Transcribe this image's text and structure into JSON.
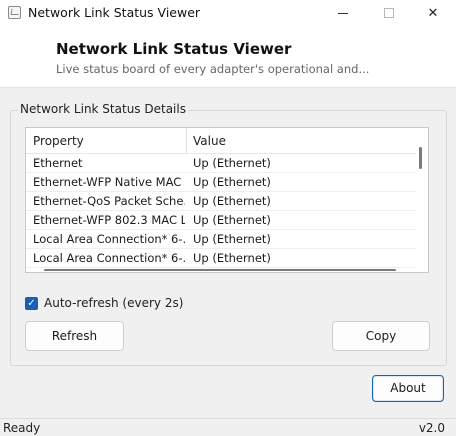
{
  "window": {
    "title": "Network Link Status Viewer",
    "controls": {
      "minimize": "minimize-icon",
      "maximize": "maximize-icon",
      "close": "✕"
    }
  },
  "header": {
    "title": "Network Link Status Viewer",
    "subtitle": "Live status board of every adapter's operational and..."
  },
  "group": {
    "label": "Network Link Status Details",
    "list": {
      "columns": [
        "Property",
        "Value"
      ],
      "rows": [
        {
          "property": "Ethernet",
          "value": "Up (Ethernet)"
        },
        {
          "property": "Ethernet-WFP Native MAC ...",
          "value": "Up (Ethernet)"
        },
        {
          "property": "Ethernet-QoS Packet Sche...",
          "value": "Up (Ethernet)"
        },
        {
          "property": "Ethernet-WFP 802.3 MAC L...",
          "value": "Up (Ethernet)"
        },
        {
          "property": "Local Area Connection* 6-...",
          "value": "Up (Ethernet)"
        },
        {
          "property": "Local Area Connection* 6-...",
          "value": "Up (Ethernet)"
        }
      ]
    },
    "auto_refresh": {
      "label": "Auto-refresh (every 2s)",
      "checked": true,
      "check_glyph": "✓"
    },
    "buttons": {
      "refresh": "Refresh",
      "copy": "Copy"
    }
  },
  "footer": {
    "about": "About"
  },
  "statusbar": {
    "left": "Ready",
    "right": "v2.0"
  },
  "colors": {
    "accent": "#1a5fb4",
    "background": "#f0f0f0",
    "header_bg": "#ffffff"
  }
}
